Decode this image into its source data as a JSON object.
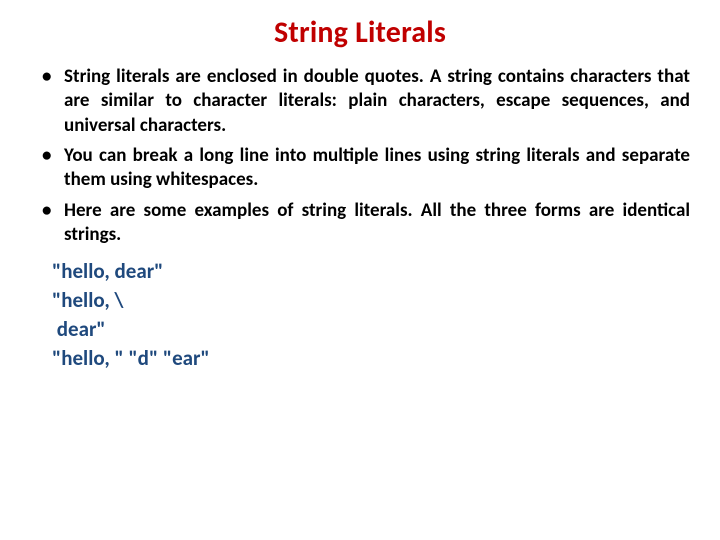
{
  "title": {
    "text": "String Literals",
    "color": "#c00000"
  },
  "bullets": [
    "String literals are enclosed in double quotes. A string contains characters that are similar to character literals: plain characters, escape sequences, and universal characters.",
    "You can break a long line into multiple lines using string literals and separate them using whitespaces.",
    "Here are some examples of string literals. All the three forms are identical strings."
  ],
  "examples": {
    "color": "#1f497d",
    "lines": [
      "\"hello, dear\"",
      "\"hello, \\",
      " dear\"",
      "\"hello, \" \"d\" \"ear\""
    ]
  }
}
